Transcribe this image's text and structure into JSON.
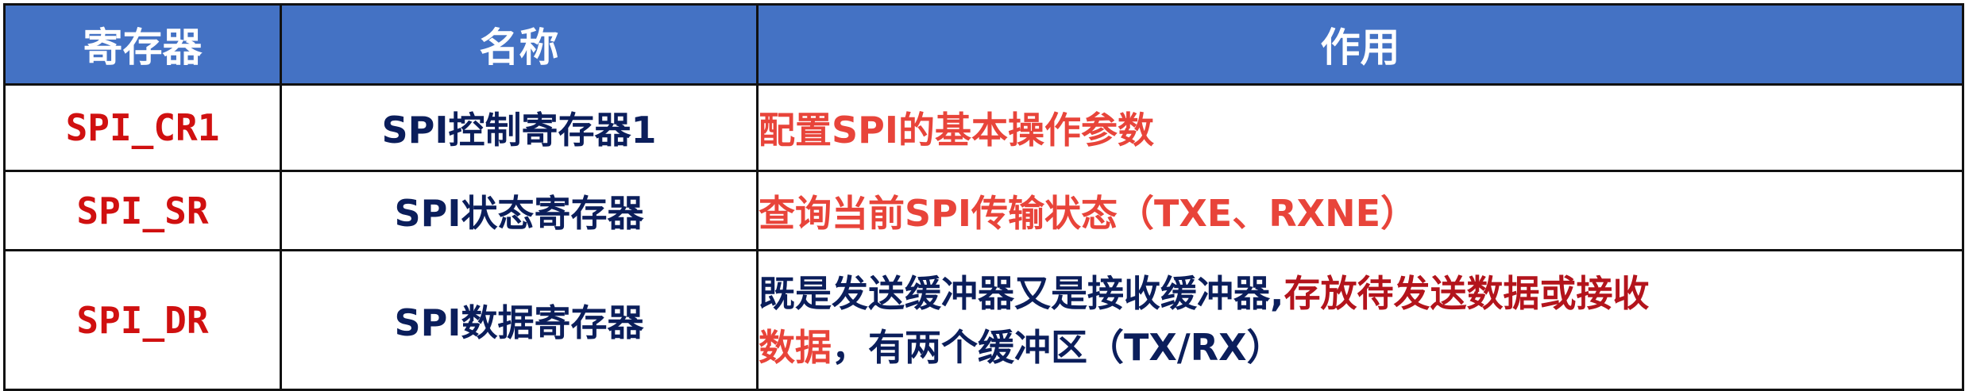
{
  "table": {
    "headers": [
      "寄存器",
      "名称",
      "作用"
    ],
    "rows": [
      {
        "code": "SPI_CR1",
        "name": "SPI控制寄存器1",
        "desc": "配置SPI的基本操作参数"
      },
      {
        "code": "SPI_SR",
        "name": "SPI状态寄存器",
        "desc": "查询当前SPI传输状态（TXE、RXNE）"
      },
      {
        "code": "SPI_DR",
        "name": "SPI数据寄存器",
        "desc_part1": "既是发送缓冲器又是接收缓冲器,",
        "desc_part2": "存放待发送数据或接收",
        "desc_part3": "数据",
        "desc_part4": "，有两个缓冲区（TX/RX）"
      }
    ]
  },
  "colors": {
    "header_bg": "#4472c4",
    "header_text": "#ffffff",
    "code_text": "#d01010",
    "name_text": "#0b1e5b",
    "desc_highlight": "#e8443a",
    "desc_dark": "#0b1e5b",
    "desc_maroon": "#b3141c"
  }
}
